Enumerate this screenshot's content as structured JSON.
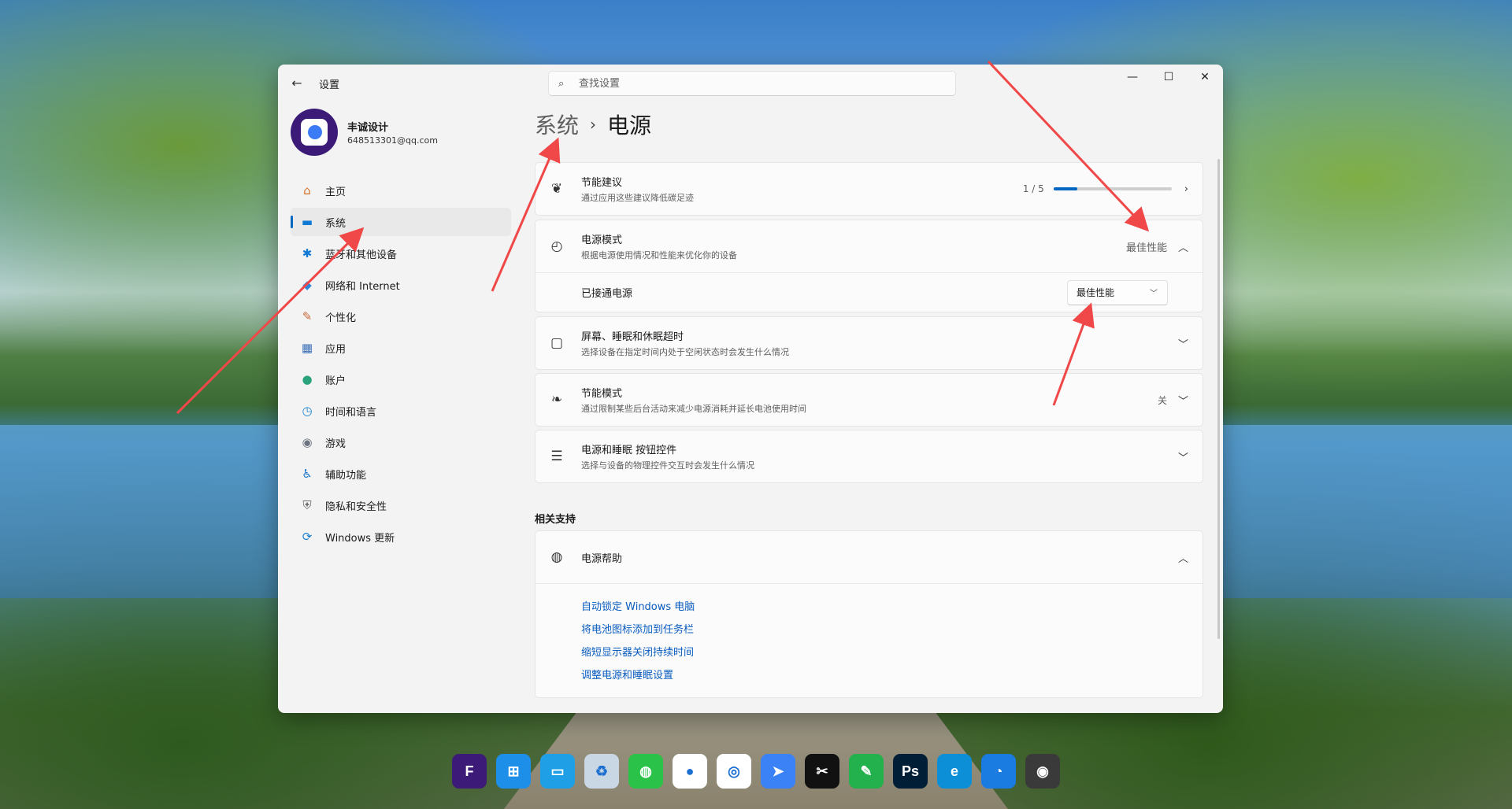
{
  "window": {
    "app_title": "设置",
    "search_placeholder": "查找设置",
    "controls": {
      "minimize": "—",
      "maximize": "☐",
      "close": "✕"
    }
  },
  "profile": {
    "name": "丰诚设计",
    "email": "648513301@qq.com"
  },
  "sidebar": {
    "items": [
      {
        "label": "主页",
        "icon": "home-icon",
        "glyph": "⌂",
        "color": "#d4712a"
      },
      {
        "label": "系统",
        "icon": "system-icon",
        "glyph": "▬",
        "color": "#0f78d4",
        "active": true
      },
      {
        "label": "蓝牙和其他设备",
        "icon": "bluetooth-icon",
        "glyph": "✱",
        "color": "#0f78d4"
      },
      {
        "label": "网络和 Internet",
        "icon": "network-icon",
        "glyph": "◆",
        "color": "#2b88d8"
      },
      {
        "label": "个性化",
        "icon": "personalization-icon",
        "glyph": "✎",
        "color": "#c76a3a"
      },
      {
        "label": "应用",
        "icon": "apps-icon",
        "glyph": "▦",
        "color": "#3a6fb6"
      },
      {
        "label": "账户",
        "icon": "accounts-icon",
        "glyph": "●",
        "color": "#2aa37c"
      },
      {
        "label": "时间和语言",
        "icon": "time-language-icon",
        "glyph": "◷",
        "color": "#1d84d0"
      },
      {
        "label": "游戏",
        "icon": "gaming-icon",
        "glyph": "◉",
        "color": "#6b7380"
      },
      {
        "label": "辅助功能",
        "icon": "accessibility-icon",
        "glyph": "♿",
        "color": "#1b74c8"
      },
      {
        "label": "隐私和安全性",
        "icon": "privacy-icon",
        "glyph": "⛨",
        "color": "#6b6b6b"
      },
      {
        "label": "Windows 更新",
        "icon": "windows-update-icon",
        "glyph": "⟳",
        "color": "#1b7fd0"
      }
    ]
  },
  "breadcrumb": {
    "parent": "系统",
    "separator": "›",
    "current": "电源"
  },
  "cards": {
    "energy": {
      "title": "节能建议",
      "desc": "通过应用这些建议降低碳足迹",
      "count": "1 / 5",
      "progress": 0.2
    },
    "power_mode": {
      "title": "电源模式",
      "desc": "根据电源使用情况和性能来优化你的设备",
      "value": "最佳性能",
      "sub_label": "已接通电源",
      "dropdown_value": "最佳性能"
    },
    "screen_sleep": {
      "title": "屏幕、睡眠和休眠超时",
      "desc": "选择设备在指定时间内处于空闲状态时会发生什么情况"
    },
    "energy_saver": {
      "title": "节能模式",
      "desc": "通过限制某些后台活动来减少电源消耗并延长电池使用时间",
      "value": "关"
    },
    "buttons": {
      "title": "电源和睡眠 按钮控件",
      "desc": "选择与设备的物理控件交互时会发生什么情况"
    }
  },
  "related": {
    "section_title": "相关支持",
    "help_title": "电源帮助",
    "links": [
      "自动锁定 Windows 电脑",
      "将电池图标添加到任务栏",
      "缩短显示器关闭持续时间",
      "调整电源和睡眠设置"
    ]
  },
  "taskbar": [
    {
      "name": "fengcheng-app-icon",
      "glyph": "F",
      "bg": "#3b1a78"
    },
    {
      "name": "windows-start-icon",
      "glyph": "⊞",
      "bg": "#1e8fe8"
    },
    {
      "name": "desktop-icon",
      "glyph": "▭",
      "bg": "#1fa0e6"
    },
    {
      "name": "recycle-bin-icon",
      "glyph": "♻",
      "bg": "#c9d6e3"
    },
    {
      "name": "wechat-icon",
      "glyph": "◍",
      "bg": "#2bc24a"
    },
    {
      "name": "qq-icon",
      "glyph": "●",
      "bg": "#ffffff"
    },
    {
      "name": "baidu-netdisk-icon",
      "glyph": "◎",
      "bg": "#ffffff"
    },
    {
      "name": "feishu-icon",
      "glyph": "➤",
      "bg": "#3b82f6"
    },
    {
      "name": "capcut-icon",
      "glyph": "✂",
      "bg": "#111111"
    },
    {
      "name": "editor-icon",
      "glyph": "✎",
      "bg": "#22b14c"
    },
    {
      "name": "photoshop-icon",
      "glyph": "Ps",
      "bg": "#001e36"
    },
    {
      "name": "edge-icon",
      "glyph": "e",
      "bg": "#0c8fd6"
    },
    {
      "name": "browser-icon",
      "glyph": "◔",
      "bg": "#1a7be0"
    },
    {
      "name": "camera-icon",
      "glyph": "◉",
      "bg": "#3a3a3a"
    }
  ],
  "colors": {
    "accent": "#0067c0",
    "annotation": "#f04848"
  }
}
